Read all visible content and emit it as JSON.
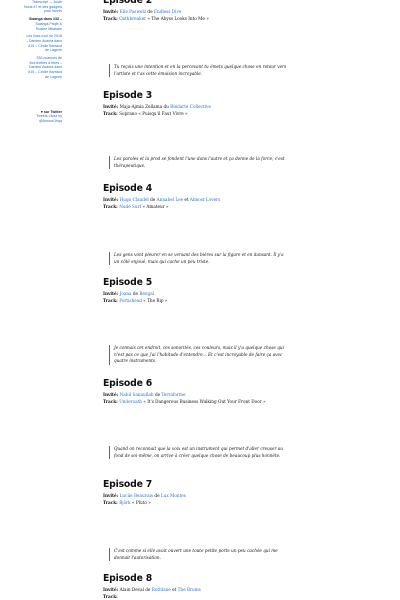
{
  "sidebar": {
    "items": [
      {
        "text": "Transcript — Juste",
        "bold": false
      },
      {
        "text": "Nous #7 et des gadgets",
        "bold": false
      },
      {
        "text": "pour tennis",
        "bold": false
      },
      {
        "text": "Swanga dans #33 –",
        "bold": true
      },
      {
        "text": "Swanga Pitqfé &",
        "bold": false
      },
      {
        "text": "Rosine Mbakam",
        "bold": false
      },
      {
        "text": "Les lives cool de 2018",
        "bold": false
      },
      {
        "text": "– Damien Avanta dans",
        "bold": false
      },
      {
        "text": "#15 – Cécile Barraud",
        "bold": false
      },
      {
        "text": "de Lagerie",
        "bold": false
      },
      {
        "text": "250 nuances de",
        "bold": false
      },
      {
        "text": "fourchettes à frites –",
        "bold": false
      },
      {
        "text": "Damien Avanta dans",
        "bold": false
      },
      {
        "text": "#15 – Cécile Barraud",
        "bold": false
      },
      {
        "text": "de Lagerie",
        "bold": false
      }
    ],
    "twitter_heading": "♥ sur Twitter",
    "twitter_lines": [
      "Tweets Liked by",
      "@AmourOhqa"
    ]
  },
  "episodes": [
    {
      "title": "Episode 2",
      "guest_label": "Invité:",
      "guest": [
        {
          "text": "Elie Paswelz",
          "link": true
        },
        {
          "text": " de ",
          "link": false
        },
        {
          "text": "Endless Dive",
          "link": true
        }
      ],
      "track_label": "Track:",
      "track": [
        {
          "text": "Oathbreaker",
          "link": true
        },
        {
          "text": " « The Abyss Looks Into Me »",
          "link": false
        }
      ],
      "quote": "Tu reçois une intention et en la percevant tu émets quelque chose en retour vers l'artiste et t'as cette émulsion incroyable."
    },
    {
      "title": "Episode 3",
      "guest_label": "Invité:",
      "guest": [
        {
          "text": "Maja-Ajmia Zellama du ",
          "link": false
        },
        {
          "text": "Blédarte Collective",
          "link": true
        }
      ],
      "track_label": "Track:",
      "track": [
        {
          "text": "Soprano « Puisqu'il Faut Vivre »",
          "link": false
        }
      ],
      "quote": "Les paroles et la prod se fondent l'une dans l'autre et ça donne de la force, c'est thérapeutique."
    },
    {
      "title": "Episode 4",
      "guest_label": "Invité:",
      "guest": [
        {
          "text": "Hugo Claudel",
          "link": true
        },
        {
          "text": " de ",
          "link": false
        },
        {
          "text": "Annabel Lee",
          "link": true
        },
        {
          "text": " et ",
          "link": false
        },
        {
          "text": "Almost Lovers",
          "link": true
        }
      ],
      "track_label": "Track:",
      "track": [
        {
          "text": "Nude Surf",
          "link": true
        },
        {
          "text": " « Amateur »",
          "link": false
        }
      ],
      "quote": "Les gens vont pleurer en se versant des bières sur la figure et en dansant. Il y'a un côté enjoué, mais qui cache un peu triste."
    },
    {
      "title": "Episode 5",
      "guest_label": "Invité:",
      "guest": [
        {
          "text": "Joana",
          "link": true
        },
        {
          "text": " de ",
          "link": false
        },
        {
          "text": "Bengal",
          "link": true
        }
      ],
      "track_label": "Track:",
      "track": [
        {
          "text": "Portishead",
          "link": true
        },
        {
          "text": " « The Rip »",
          "link": false
        }
      ],
      "quote": "Je connais cet endroit, ces sonorités, ces couleurs, mais il y'a quelque chose qui n'est pas ce que j'ai l'habitude d'entendre... Et c'est incroyable de faire ça avec quatre instruments."
    },
    {
      "title": "Episode 6",
      "guest_label": "Invité:",
      "guest": [
        {
          "text": "Nabil Sanaullah",
          "link": true
        },
        {
          "text": " de ",
          "link": false
        },
        {
          "text": "Terraforme",
          "link": true
        }
      ],
      "track_label": "Track:",
      "track": [
        {
          "text": "Underoath",
          "link": true
        },
        {
          "text": " « It's Dangerous Business Walking Out Your Front Door »",
          "link": false
        }
      ],
      "quote": "Quand on reconnait que la voix est un instrument qui permet d'aller creuser au fond de soi-même, on arrive à créer quelque chose de beaucoup plus honnête."
    },
    {
      "title": "Episode 7",
      "guest_label": "Invité:",
      "guest": [
        {
          "text": "Lucile Beauvais",
          "link": true
        },
        {
          "text": " de ",
          "link": false
        },
        {
          "text": "Lux Montes",
          "link": true
        }
      ],
      "track_label": "Track:",
      "track": [
        {
          "text": "Björk",
          "link": true
        },
        {
          "text": " « Pluto »",
          "link": false
        }
      ],
      "quote": "C'est comme si elle avait ouvert une toute petite porte un peu cachée qui me donnait l'autorisation."
    },
    {
      "title": "Episode 8",
      "guest_label": "Invité:",
      "guest": [
        {
          "text": "Alain Deval",
          "link": false
        },
        {
          "text": " de ",
          "link": false
        },
        {
          "text": "Rothlane",
          "link": true
        },
        {
          "text": " et ",
          "link": false
        },
        {
          "text": "The Brums",
          "link": true
        }
      ],
      "track_label": "Track:",
      "track": [
        {
          "text": "",
          "link": false
        }
      ],
      "quote": ""
    }
  ],
  "colors": {
    "link": "#2a72c8",
    "quote_border": "#2a72c8",
    "text": "#111111"
  }
}
